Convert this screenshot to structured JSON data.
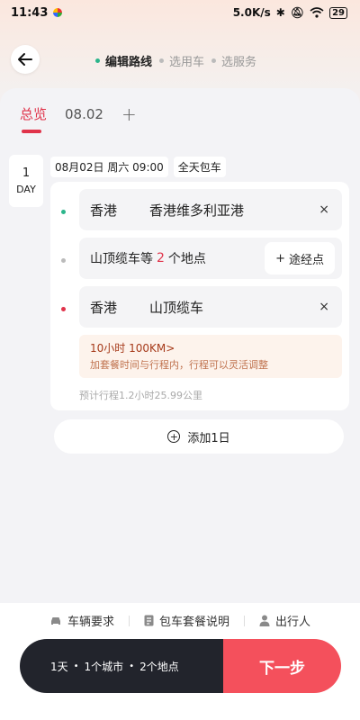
{
  "status": {
    "time": "11:43",
    "speed": "5.0K/s",
    "battery": "29"
  },
  "steps": [
    {
      "label": "编辑路线"
    },
    {
      "label": "选用车"
    },
    {
      "label": "选服务"
    }
  ],
  "tabs": {
    "overview": "总览",
    "date": "08.02",
    "add": "+"
  },
  "day": {
    "num": "1",
    "unit": "DAY",
    "date": "08月02日 周六 09:00",
    "type": "全天包车"
  },
  "stops": [
    {
      "city": "香港",
      "place": "香港维多利亚港",
      "dot_color": "#2bb58b"
    },
    {
      "summary_prefix": "山顶缆车等",
      "summary_count": "2",
      "summary_suffix": "个地点",
      "via_label": "途经点",
      "dot_color": "#bbbbbb"
    },
    {
      "city": "香港",
      "place": "山顶缆车",
      "dot_color": "#e0334a"
    }
  ],
  "close_glyph": "×",
  "package": {
    "title": "10小时 100KM",
    "arrow": ">",
    "subtitle": "加套餐时间与行程内，行程可以灵活调整"
  },
  "estimate": "预计行程1.2小时25.99公里",
  "add_day": "添加1日",
  "links": [
    {
      "label": "车辆要求",
      "icon": "car-icon"
    },
    {
      "label": "包车套餐说明",
      "icon": "document-icon"
    },
    {
      "label": "出行人",
      "icon": "person-icon"
    }
  ],
  "cta": {
    "days": "1天",
    "cities": "1个城市",
    "places": "2个地点",
    "next": "下一步"
  }
}
